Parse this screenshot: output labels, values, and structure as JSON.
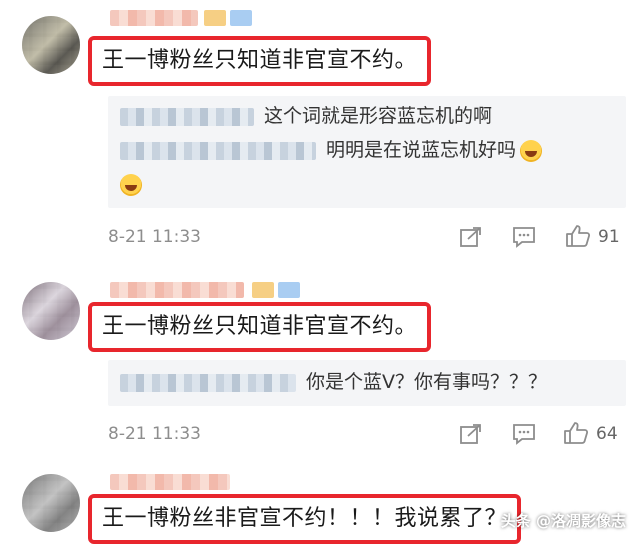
{
  "comments": [
    {
      "text": "王一博粉丝只知道非官宣不约。",
      "replies": [
        {
          "text": "这个词就是形容蓝忘机的啊"
        },
        {
          "text": "明明是在说蓝忘机好吗"
        }
      ],
      "timestamp": "8-21 11:33",
      "likes": "91"
    },
    {
      "text": "王一博粉丝只知道非官宣不约。",
      "replies": [
        {
          "text": "你是个蓝V？你有事吗？？？"
        }
      ],
      "timestamp": "8-21 11:33",
      "likes": "64"
    },
    {
      "text": "王一博粉丝非官宣不约！！！我说累了？"
    }
  ],
  "watermark": "头条 @洛凋影像志",
  "icons": {
    "share": "share-icon",
    "reply": "comment-icon",
    "like": "thumbs-up-icon",
    "emoji": "laughing-emoji-icon"
  },
  "colors": {
    "highlight_border": "#e8262d",
    "reply_bg": "#f4f5f7",
    "meta_text": "#8d8d8d"
  }
}
